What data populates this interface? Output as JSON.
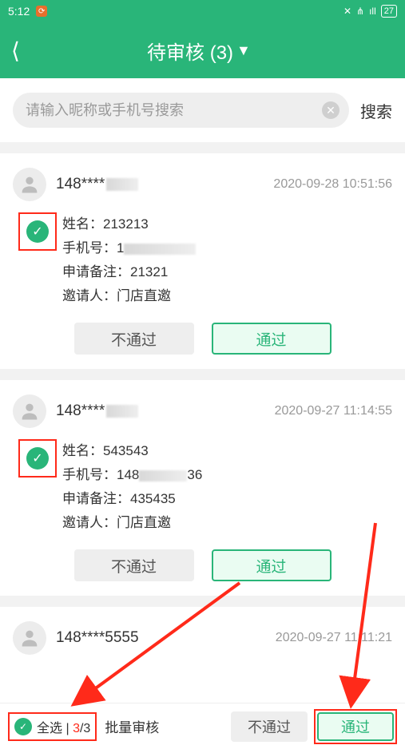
{
  "status": {
    "time": "5:12",
    "battery": "27"
  },
  "header": {
    "title": "待审核 (3)"
  },
  "search": {
    "placeholder": "请输入昵称或手机号搜索",
    "button": "搜索"
  },
  "labels": {
    "name": "姓名：",
    "phone": "手机号：",
    "remark": "申请备注：",
    "inviter": "邀请人：",
    "reject": "不通过",
    "approve": "通过"
  },
  "cards": [
    {
      "nick_prefix": "148****",
      "ts": "2020-09-28 10:51:56",
      "name": "213213",
      "phone_prefix": "1",
      "remark": "21321",
      "inviter": "门店直邀"
    },
    {
      "nick_prefix": "148****",
      "ts": "2020-09-27 11:14:55",
      "name": "543543",
      "phone_prefix": "148",
      "phone_suffix": "36",
      "remark": "435435",
      "inviter": "门店直邀"
    },
    {
      "nick_prefix": "148****5555",
      "ts": "2020-09-27 11:11:21"
    }
  ],
  "bottom": {
    "select_all": "全选 | ",
    "count_sel": "3",
    "count_sep": "/3",
    "bulk": "批量审核",
    "reject": "不通过",
    "approve": "通过"
  }
}
